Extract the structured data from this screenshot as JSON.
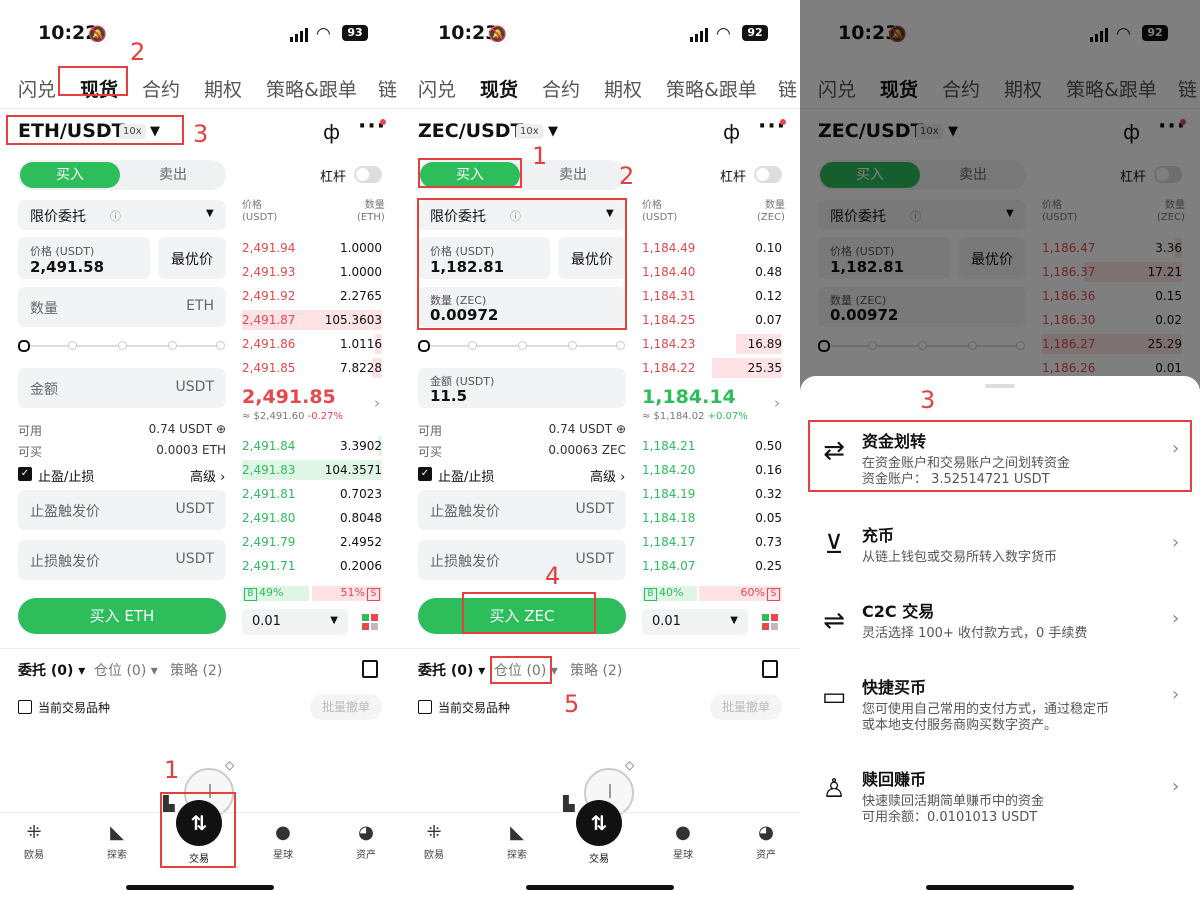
{
  "status": [
    {
      "time": "10:22",
      "battery": "93"
    },
    {
      "time": "10:23",
      "battery": "92"
    },
    {
      "time": "10:23",
      "battery": "92"
    }
  ],
  "tabs": [
    "闪兑",
    "现货",
    "合约",
    "期权",
    "策略&跟单",
    "链"
  ],
  "leverage_tag": "10x",
  "buy_tab": "买入",
  "sell_tab": "卖出",
  "leverage_label": "杠杆",
  "order_type": "限价委托",
  "best_price": "最优价",
  "avail_label": "可用",
  "can_buy_label": "可买",
  "tpsl_label": "止盈/止损",
  "advanced": "高级 ›",
  "tp_trigger": "止盈触发价",
  "sl_trigger": "止损触发价",
  "book_price_hd": "价格\n(USDT)",
  "book_qty_hd": "数量",
  "order_tabs": {
    "orders": "委托 (0)",
    "positions": "仓位 (0)",
    "strategy": "策略 (2)"
  },
  "current_pair": "当前交易品种",
  "bulk_cancel": "批量撤单",
  "tabbar": [
    "欧易",
    "探索",
    "交易",
    "星球",
    "资产"
  ],
  "precision": "0.01",
  "p1": {
    "pair": "ETH/USDT",
    "price_label": "价格 (USDT)",
    "price": "2,491.58",
    "qty_placeholder": "数量",
    "qty_unit": "ETH",
    "amount_placeholder": "金额",
    "amount_unit": "USDT",
    "avail": "0.74 USDT ⊕",
    "can_buy": "0.0003 ETH",
    "tp_unit": "USDT",
    "sl_unit": "USDT",
    "buy_btn": "买入 ETH",
    "qty_hd": "(ETH)",
    "asks": [
      [
        "2,491.94",
        "1.0000",
        0
      ],
      [
        "2,491.93",
        "1.0000",
        0
      ],
      [
        "2,491.92",
        "2.2765",
        0
      ],
      [
        "2,491.87",
        "105.3603",
        1
      ],
      [
        "2,491.86",
        "1.0116",
        0.05
      ],
      [
        "2,491.85",
        "7.8228",
        0.07
      ]
    ],
    "last": "2,491.85",
    "last_sub": "≈ $2,491.60",
    "last_chg": "-0.27%",
    "bids": [
      [
        "2,491.84",
        "3.3902",
        0.03
      ],
      [
        "2,491.83",
        "104.3571",
        1
      ],
      [
        "2,491.81",
        "0.7023",
        0
      ],
      [
        "2,491.80",
        "0.8048",
        0
      ],
      [
        "2,491.79",
        "2.4952",
        0
      ],
      [
        "2,491.71",
        "0.2006",
        0
      ]
    ],
    "buy_pct": "49%",
    "sell_pct": "51%",
    "buy_frac": 0.49,
    "markers": [
      "2",
      "3",
      "1"
    ]
  },
  "p2": {
    "pair": "ZEC/USDT",
    "price_label": "价格 (USDT)",
    "price": "1,182.81",
    "qty_label": "数量 (ZEC)",
    "qty": "0.00972",
    "amount_label": "金额 (USDT)",
    "amount": "11.5",
    "avail": "0.74 USDT ⊕",
    "can_buy": "0.00063 ZEC",
    "tp_unit": "USDT",
    "sl_unit": "USDT",
    "buy_btn": "买入 ZEC",
    "qty_hd": "(ZEC)",
    "asks": [
      [
        "1,184.49",
        "0.10",
        0
      ],
      [
        "1,184.40",
        "0.48",
        0
      ],
      [
        "1,184.31",
        "0.12",
        0
      ],
      [
        "1,184.25",
        "0.07",
        0
      ],
      [
        "1,184.23",
        "16.89",
        0.33
      ],
      [
        "1,184.22",
        "25.35",
        0.5
      ]
    ],
    "last": "1,184.14",
    "last_sub": "≈ $1,184.02",
    "last_chg": "+0.07%",
    "bids": [
      [
        "1,184.21",
        "0.50",
        0
      ],
      [
        "1,184.20",
        "0.16",
        0
      ],
      [
        "1,184.19",
        "0.32",
        0
      ],
      [
        "1,184.18",
        "0.05",
        0
      ],
      [
        "1,184.17",
        "0.73",
        0
      ],
      [
        "1,184.07",
        "0.25",
        0
      ]
    ],
    "buy_pct": "40%",
    "sell_pct": "60%",
    "buy_frac": 0.4,
    "markers": [
      "1",
      "2",
      "4",
      "5"
    ]
  },
  "p3": {
    "pair": "ZEC/USDT",
    "price_label": "价格 (USDT)",
    "price": "1,182.81",
    "qty_label": "数量 (ZEC)",
    "qty": "0.00972",
    "qty_hd": "(ZEC)",
    "asks": [
      [
        "1,186.47",
        "3.36",
        0.05
      ],
      [
        "1,186.37",
        "17.21",
        0.7
      ],
      [
        "1,186.36",
        "0.15",
        0
      ],
      [
        "1,186.30",
        "0.02",
        0
      ],
      [
        "1,186.27",
        "25.29",
        1
      ],
      [
        "1,186.26",
        "0.01",
        0
      ]
    ],
    "marker": "3",
    "menu": [
      {
        "icon": "⇄",
        "title": "资金划转",
        "d1": "在资金账户和交易账户之间划转资金",
        "d2": "资金账户： 3.52514721 USDT"
      },
      {
        "icon": "⊻",
        "title": "充币",
        "d1": "从链上钱包或交易所转入数字货币",
        "d2": ""
      },
      {
        "icon": "⇌",
        "title": "C2C 交易",
        "d1": "灵活选择 100+ 收付款方式，0 手续费",
        "d2": ""
      },
      {
        "icon": "▭",
        "title": "快捷买币",
        "d1": "您可使用自己常用的支付方式，通过稳定币",
        "d2": "或本地支付服务商购买数字资产。"
      },
      {
        "icon": "♙",
        "title": "赎回赚币",
        "d1": "快速赎回活期简单赚币中的资金",
        "d2": "可用余额：0.0101013 USDT"
      }
    ]
  },
  "colors": {
    "green": "#2dbd5b",
    "red": "#e5484d",
    "annot": "#e3403f"
  }
}
